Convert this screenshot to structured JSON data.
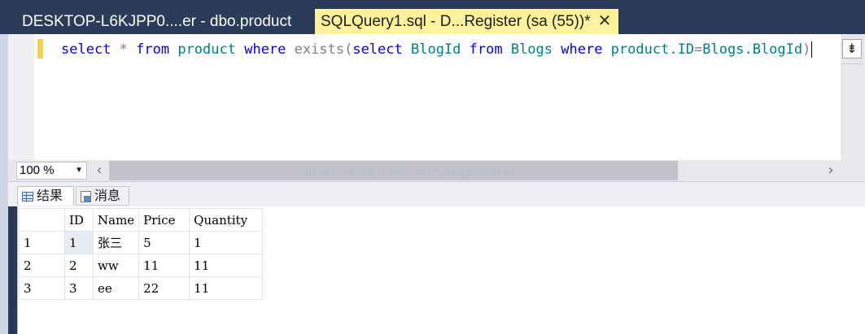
{
  "tabs": {
    "inactive_label": "DESKTOP-L6KJPP0....er - dbo.product",
    "active_label": "SQLQuery1.sql - D...Register (sa (55))*",
    "close_glyph": "✕"
  },
  "editor": {
    "tokens": {
      "t1": "select",
      "t2": " * ",
      "t3": "from",
      "t4": " product ",
      "t5": "where",
      "t6": " ",
      "t7": "exists",
      "t8": "(",
      "t9": "select",
      "t10": " BlogId ",
      "t11": "from",
      "t12": " Blogs ",
      "t13": "where",
      "t14": " product.",
      "t15": "ID",
      "t16": "=",
      "t17": "Blogs.BlogId",
      "t18": ")"
    },
    "split_glyph": "⇟"
  },
  "zoom": {
    "value": "100 %",
    "arrow": "▼"
  },
  "hscroll": {
    "left_arrow": "‹",
    "right_arrow": "›"
  },
  "watermark": "http://blog.csdn.net/yangyangafan",
  "result_tabs": {
    "results": "结果",
    "messages": "消息"
  },
  "grid": {
    "columns": [
      "",
      "ID",
      "Name",
      "Price",
      "Quantity"
    ],
    "rows": [
      [
        "1",
        "1",
        "张三",
        "5",
        "1"
      ],
      [
        "2",
        "2",
        "ww",
        "11",
        "11"
      ],
      [
        "3",
        "3",
        "ee",
        "22",
        "11"
      ]
    ]
  },
  "colors": {
    "titlebar": "#2b3c59",
    "active_tab": "#fff29d",
    "keyword": "#0000ff",
    "function": "#ff00ff",
    "object": "#008080",
    "operator": "#808080",
    "change_marker": "#f2d546"
  }
}
